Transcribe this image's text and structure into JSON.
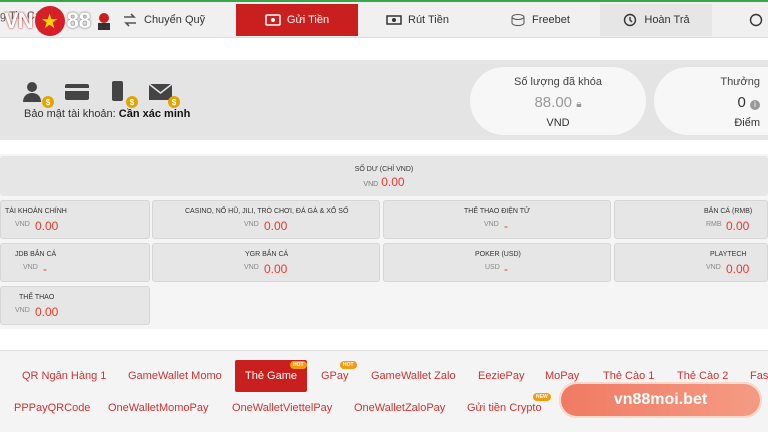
{
  "nav": {
    "breadcrumb": "g Tin Cá N",
    "logo_text": "VN",
    "logo_number": "88",
    "tabs": [
      {
        "label": "Chuyển Quỹ",
        "icon": "transfer-icon"
      },
      {
        "label": "Gửi Tiền",
        "icon": "deposit-icon",
        "active": true
      },
      {
        "label": "Rút Tiền",
        "icon": "withdraw-icon"
      },
      {
        "label": "Freebet",
        "icon": "coins-icon"
      },
      {
        "label": "Hoàn Trả",
        "icon": "refund-icon"
      }
    ]
  },
  "account": {
    "security_label": "Bảo mật tài khoản:",
    "security_value": "Cần xác minh",
    "icons": [
      "user-verify-icon",
      "card-icon",
      "phone-icon",
      "email-icon"
    ],
    "locked": {
      "title": "Số lượng đã khóa",
      "value": "88.00",
      "unit": "VND"
    },
    "reward": {
      "title": "Thưởng",
      "value": "0",
      "unit": "Điểm"
    }
  },
  "balance": {
    "total_label": "SỐ DƯ (CHỈ VND)",
    "total_currency": "VND",
    "total_value": "0.00",
    "cells": [
      {
        "label": "TÀI KHOẢN CHÍNH",
        "currency": "VND",
        "value": "0.00"
      },
      {
        "label": "CASINO, NỔ HŨ, JILI, TRÒ CHƠI, ĐÁ GÀ & XỔ SỐ",
        "currency": "VND",
        "value": "0.00"
      },
      {
        "label": "THỂ THAO ĐIỆN TỬ",
        "currency": "VND",
        "value": "-"
      },
      {
        "label": "BẮN CÁ (RMB)",
        "currency": "RMB",
        "value": "0.00"
      },
      {
        "label": "JDB BẮN CÁ",
        "currency": "VND",
        "value": "-"
      },
      {
        "label": "YGR BẮN CÁ",
        "currency": "VND",
        "value": "0.00"
      },
      {
        "label": "POKER (USD)",
        "currency": "USD",
        "value": "-"
      },
      {
        "label": "PLAYTECH",
        "currency": "VND",
        "value": "0.00"
      },
      {
        "label": "THỂ THAO",
        "currency": "VND",
        "value": "0.00"
      }
    ]
  },
  "payment_methods": {
    "row1": [
      "QR Ngân Hàng 1",
      "GameWallet Momo",
      "Thẻ Game",
      "GPay",
      "GameWallet Zalo",
      "EeziePay",
      "MoPay",
      "Thẻ Cào 1",
      "Thẻ Cào 2",
      "Fast"
    ],
    "row2": [
      "PPPayQRCode",
      "OneWalletMomoPay",
      "OneWalletViettelPay",
      "OneWalletZaloPay",
      "Gửi tiền Crypto"
    ],
    "hot_badge": "HOT",
    "new_badge": "NEW"
  },
  "banner": {
    "text": "vn88moi.bet"
  }
}
